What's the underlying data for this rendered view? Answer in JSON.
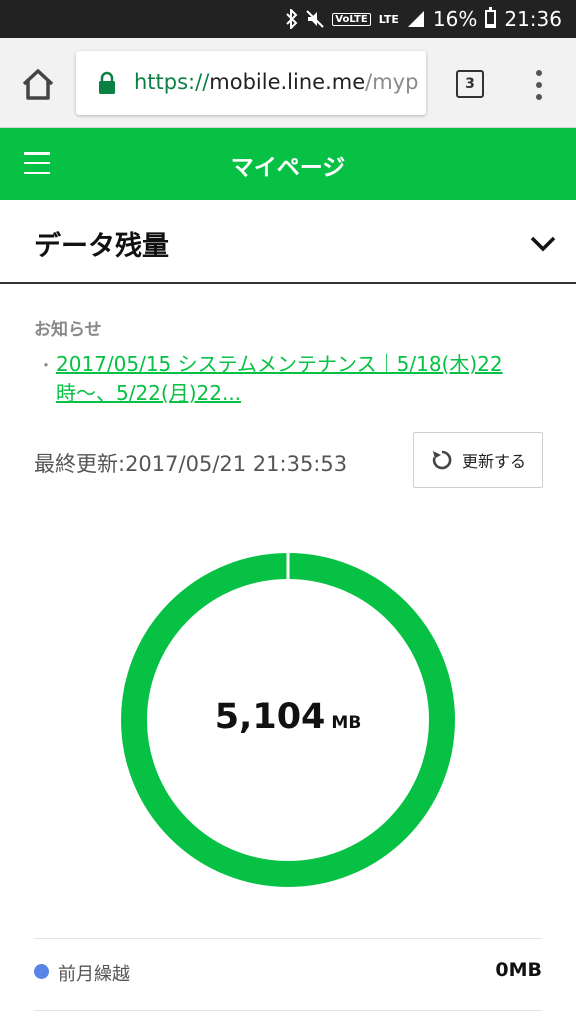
{
  "status_bar": {
    "battery_percent": "16%",
    "battery_level": 0.16,
    "time": "21:36",
    "volte": "VoLTE",
    "lte": "LTE"
  },
  "browser": {
    "url_scheme": "https://",
    "url_host": "mobile.line.me",
    "url_path": "/myp",
    "tab_count": "3"
  },
  "header": {
    "title": "マイページ"
  },
  "section": {
    "title": "データ残量"
  },
  "notices": {
    "label": "お知らせ",
    "bullet": "・",
    "items": [
      {
        "text": "2017/05/15 システムメンテナンス｜5/18(木)22時〜、5/22(月)22..."
      }
    ]
  },
  "update": {
    "label": "最終更新:2017/05/21 21:35:53",
    "refresh_button": "更新する"
  },
  "usage": {
    "remaining_value": "5,104",
    "remaining_unit": "MB",
    "ring_color": "#06c143"
  },
  "breakdown": [
    {
      "label": "前月繰越",
      "value": "0MB",
      "color": "#5a84e6"
    }
  ],
  "colors": {
    "brand_green": "#06c143",
    "link_green": "#06c143"
  }
}
